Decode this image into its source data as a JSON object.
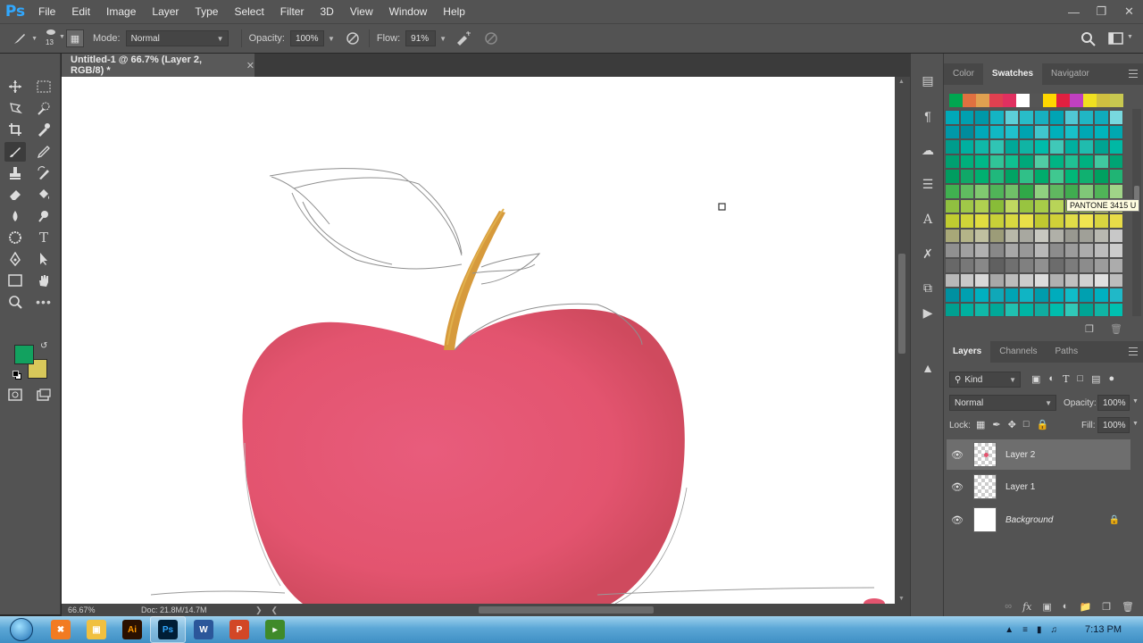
{
  "app": {
    "logo": "Ps"
  },
  "menubar": {
    "items": [
      "File",
      "Edit",
      "Image",
      "Layer",
      "Type",
      "Select",
      "Filter",
      "3D",
      "View",
      "Window",
      "Help"
    ]
  },
  "options": {
    "brush_size": "13",
    "mode_label": "Mode:",
    "mode_value": "Normal",
    "opacity_label": "Opacity:",
    "opacity_value": "100%",
    "flow_label": "Flow:",
    "flow_value": "91%"
  },
  "document": {
    "tab_title": "Untitled-1 @ 66.7% (Layer 2, RGB/8) *",
    "zoom": "66.67%",
    "doc_size": "Doc: 21.8M/14.7M"
  },
  "colors": {
    "foreground": "#12a15f",
    "background": "#d8c85a"
  },
  "swatches_panel": {
    "tabs": [
      "Color",
      "Swatches",
      "Navigator"
    ],
    "active_tab": "Swatches",
    "tooltip": "PANTONE 3415 U",
    "recent": [
      "#00a650",
      "#e07040",
      "#e0a050",
      "#e04050",
      "#e03060",
      "#ffffff",
      "#555555",
      "#ffd700",
      "#e02040",
      "#c040c0",
      "#f0e020",
      "#d0c040",
      "#c8c850"
    ]
  },
  "layers_panel": {
    "tabs": [
      "Layers",
      "Channels",
      "Paths"
    ],
    "active_tab": "Layers",
    "filter_kind": "Kind",
    "blend_mode": "Normal",
    "opacity_label": "Opacity:",
    "opacity_value": "100%",
    "lock_label": "Lock:",
    "fill_label": "Fill:",
    "fill_value": "100%",
    "layers": [
      {
        "name": "Layer 2",
        "selected": true
      },
      {
        "name": "Layer 1",
        "selected": false
      },
      {
        "name": "Background",
        "selected": false,
        "locked": true
      }
    ]
  },
  "taskbar": {
    "clock": "7:13 PM",
    "apps": [
      "start-orb",
      "xampp",
      "file-explorer",
      "illustrator",
      "photoshop",
      "word",
      "powerpoint",
      "greenshot"
    ]
  }
}
